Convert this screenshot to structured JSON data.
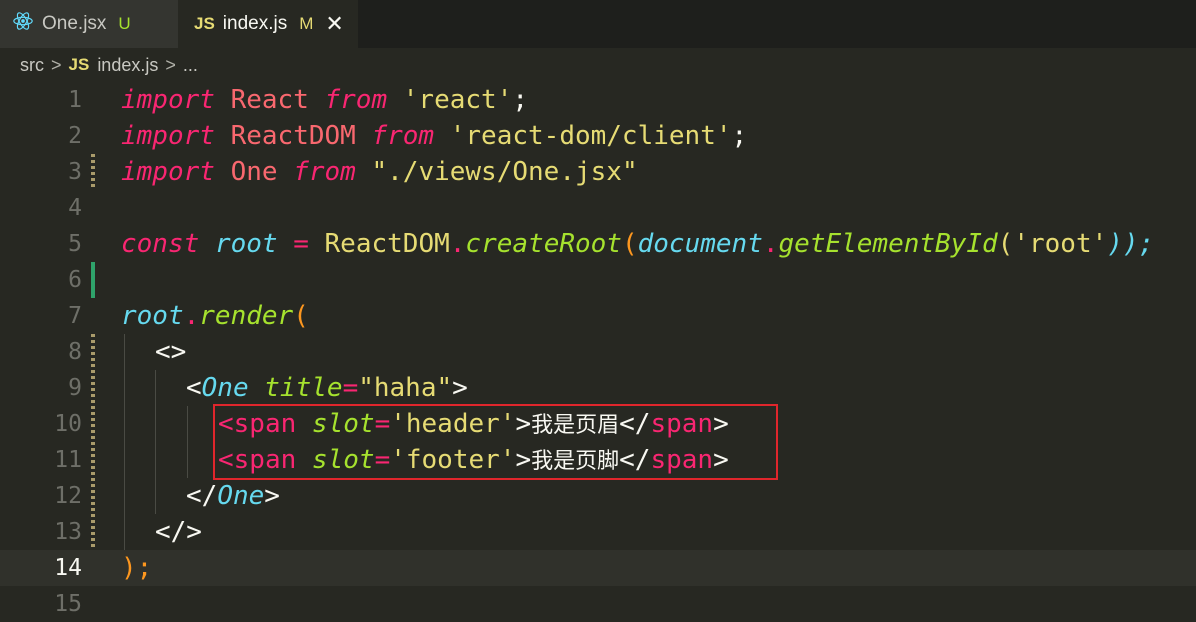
{
  "tabs": [
    {
      "icon": "react-icon",
      "label": "One.jsx",
      "badge": "U",
      "active": false
    },
    {
      "icon": "js-icon",
      "icon_text": "JS",
      "label": "index.js",
      "badge": "M",
      "close": "✕",
      "active": true
    }
  ],
  "breadcrumb": {
    "items": [
      "src",
      "index.js",
      "..."
    ],
    "separator": ">",
    "js_badge": "JS"
  },
  "editor": {
    "current_line": 14,
    "line_numbers": [
      "1",
      "2",
      "3",
      "4",
      "5",
      "6",
      "7",
      "8",
      "9",
      "10",
      "11",
      "12",
      "13",
      "14",
      "15"
    ],
    "lines": {
      "l1": [
        "import",
        " React ",
        "from",
        " ",
        "'react'",
        ";"
      ],
      "l2": [
        "import",
        " ReactDOM ",
        "from",
        " ",
        "'react-dom/client'",
        ";"
      ],
      "l3": [
        "import",
        " One ",
        "from",
        " ",
        "\"./views/One.jsx\""
      ],
      "l5": [
        "const",
        " ",
        "root",
        " = ",
        "ReactDOM",
        ".",
        "createRoot",
        "(",
        "document",
        ".",
        "getElementById",
        "(",
        "'root'",
        "));"
      ],
      "l7": [
        "root",
        ".",
        "render",
        "("
      ],
      "l8": [
        "<>"
      ],
      "l9": [
        "<",
        "One",
        " ",
        "title",
        "=",
        "\"haha\"",
        ">"
      ],
      "l10": [
        "<",
        "span",
        " ",
        "slot",
        "=",
        "'header'",
        ">",
        "我是页眉",
        "</",
        "span",
        ">"
      ],
      "l11": [
        "<",
        "span",
        " ",
        "slot",
        "=",
        "'footer'",
        ">",
        "我是页脚",
        "</",
        "span",
        ">"
      ],
      "l12": [
        "</",
        "One",
        ">"
      ],
      "l13": [
        "</>"
      ],
      "l14": [
        ");"
      ]
    }
  },
  "colors": {
    "background": "#272822",
    "keyword": "#f92672",
    "string": "#e6db74",
    "function": "#a6e22e",
    "variable": "#66d9ef",
    "highlight_box": "#e0262c"
  }
}
